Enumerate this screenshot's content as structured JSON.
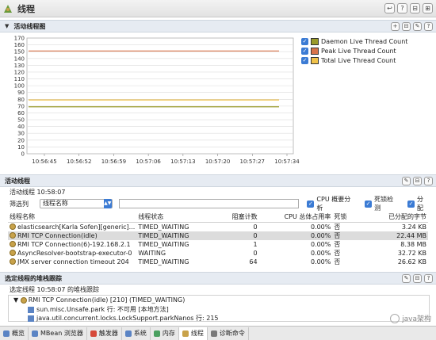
{
  "title": "线程",
  "tools": [
    "↩",
    "?",
    "⊟",
    "⊞"
  ],
  "chart_section": {
    "label": "活动线程图",
    "tools": [
      "+",
      "⊟",
      "✎",
      "?"
    ]
  },
  "chart_data": {
    "type": "line",
    "x": [
      "10:56:45",
      "10:56:52",
      "10:56:59",
      "10:57:06",
      "10:57:13",
      "10:57:20",
      "10:57:27",
      "10:57:34"
    ],
    "series": [
      {
        "name": "Daemon Live Thread Count",
        "values": [
          69,
          69,
          69,
          69,
          69,
          69,
          69,
          69
        ],
        "color": "#9a9a2a"
      },
      {
        "name": "Peak Live Thread Count",
        "values": [
          151,
          151,
          151,
          151,
          151,
          151,
          151,
          151
        ],
        "color": "#d8734a"
      },
      {
        "name": "Total Live Thread Count",
        "values": [
          79,
          79,
          79,
          79,
          79,
          79,
          79,
          79
        ],
        "color": "#f0c24a"
      }
    ],
    "yticks": [
      0,
      10,
      20,
      30,
      40,
      50,
      60,
      70,
      80,
      90,
      100,
      110,
      120,
      130,
      140,
      150,
      160,
      170
    ],
    "ylim": [
      0,
      170
    ],
    "grid": true,
    "legend": "right"
  },
  "legend_items": [
    {
      "label": "Daemon Live Thread Count",
      "color": "#9a9a2a"
    },
    {
      "label": "Peak Live Thread Count",
      "color": "#d8734a"
    },
    {
      "label": "Total Live Thread Count",
      "color": "#f0c24a"
    }
  ],
  "active_section": {
    "label": "活动线程",
    "tools": [
      "✎",
      "⊟",
      "?"
    ],
    "timestamp": "活动线程 10:58:07",
    "filter_label": "筛选列",
    "filter_value": "线程名称",
    "checkboxes": [
      "CPU 概要分析",
      "死锁检测",
      "分配"
    ]
  },
  "thread_table": {
    "columns": [
      "线程名称",
      "线程状态",
      "阻塞计数",
      "CPU 总体占用率",
      "死锁",
      "已分配的字节"
    ],
    "rows": [
      [
        "elasticsearch[Karla Sofen][generic]...",
        "TIMED_WAITING",
        "0",
        "0.00%",
        "否",
        "3.24 KB"
      ],
      [
        "RMI TCP Connection(idle)",
        "TIMED_WAITING",
        "0",
        "0.00%",
        "否",
        "22.44 MB"
      ],
      [
        "RMI TCP Connection(6)-192.168.2.1",
        "TIMED_WAITING",
        "1",
        "0.00%",
        "否",
        "8.38 MB"
      ],
      [
        "AsyncResolver-bootstrap-executor-0",
        "WAITING",
        "0",
        "0.00%",
        "否",
        "32.72 KB"
      ],
      [
        "JMX server connection timeout 204",
        "TIMED_WAITING",
        "64",
        "0.00%",
        "否",
        "26.62 KB"
      ]
    ],
    "selected_row": 1
  },
  "stack_section": {
    "label": "选定线程的堆栈跟踪",
    "tools": [
      "✎",
      "⊟",
      "?"
    ],
    "timestamp": "选定线程 10:58:07 的堆栈跟踪",
    "lines": [
      "RMI TCP Connection(idle) [210] (TIMED_WAITING)",
      "sun.misc.Unsafe.park 行: 不可用 [本地方法]",
      "java.util.concurrent.locks.LockSupport.parkNanos 行: 215"
    ]
  },
  "bottom_tabs": [
    {
      "label": "概览",
      "color": "#5b84c4"
    },
    {
      "label": "MBean 浏览器",
      "color": "#5b84c4"
    },
    {
      "label": "触发器",
      "color": "#d64a3a"
    },
    {
      "label": "系统",
      "color": "#5b84c4"
    },
    {
      "label": "内存",
      "color": "#4aa060"
    },
    {
      "label": "线程",
      "color": "#c8a24a"
    },
    {
      "label": "诊断命令",
      "color": "#7a7a7a"
    }
  ],
  "active_tab": 5,
  "watermark": "java架构"
}
